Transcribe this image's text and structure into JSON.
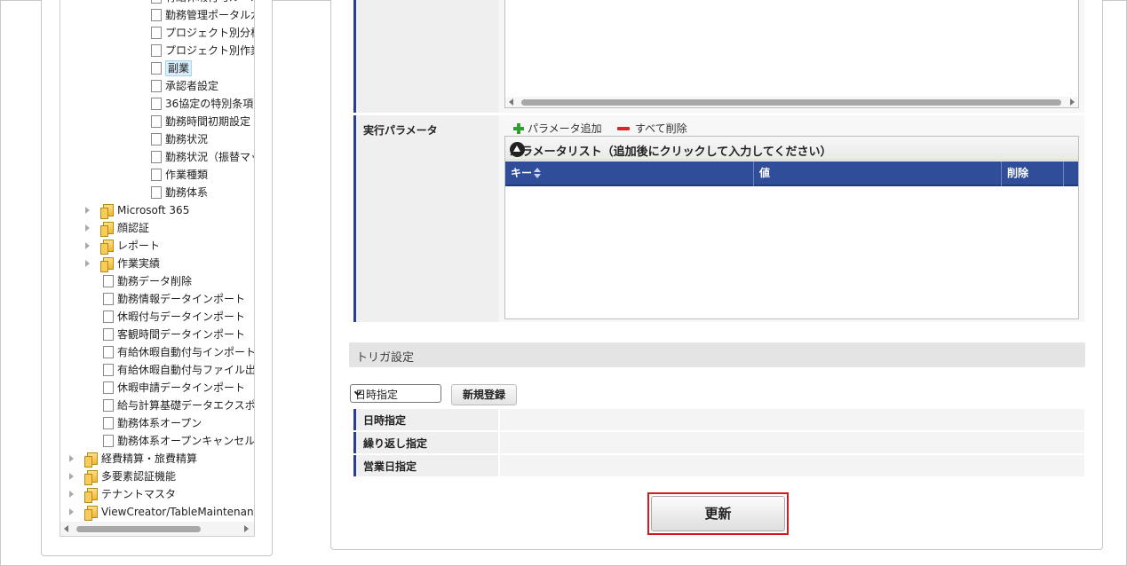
{
  "tree": {
    "items": [
      {
        "label": "有給休暇付与ルール",
        "type": "doc",
        "level": 4
      },
      {
        "label": "勤務管理ポータルガジェ",
        "type": "doc",
        "level": 4
      },
      {
        "label": "プロジェクト別分析",
        "type": "doc",
        "level": 4
      },
      {
        "label": "プロジェクト別作業種",
        "type": "doc",
        "level": 4
      },
      {
        "label": "副業",
        "type": "doc",
        "level": 4,
        "selected": true
      },
      {
        "label": "承認者設定",
        "type": "doc",
        "level": 4
      },
      {
        "label": "36協定の特別条項",
        "type": "doc",
        "level": 4
      },
      {
        "label": "勤務時間初期設定",
        "type": "doc",
        "level": 4
      },
      {
        "label": "勤務状況",
        "type": "doc",
        "level": 4
      },
      {
        "label": "勤務状況（振替マッピ",
        "type": "doc",
        "level": 4
      },
      {
        "label": "作業種類",
        "type": "doc",
        "level": 4
      },
      {
        "label": "勤務体系",
        "type": "doc",
        "level": 4
      },
      {
        "label": "Microsoft 365",
        "type": "folder",
        "level": 3,
        "expandable": true
      },
      {
        "label": "顔認証",
        "type": "folder",
        "level": 3,
        "expandable": true
      },
      {
        "label": "レポート",
        "type": "folder",
        "level": 3,
        "expandable": true
      },
      {
        "label": "作業実績",
        "type": "folder",
        "level": 3,
        "expandable": true
      },
      {
        "label": "勤務データ削除",
        "type": "doc",
        "level": 3
      },
      {
        "label": "勤務情報データインポート",
        "type": "doc",
        "level": 3
      },
      {
        "label": "休暇付与データインポート",
        "type": "doc",
        "level": 3
      },
      {
        "label": "客観時間データインポート",
        "type": "doc",
        "level": 3
      },
      {
        "label": "有給休暇自動付与インポート",
        "type": "doc",
        "level": 3
      },
      {
        "label": "有給休暇自動付与ファイル出",
        "type": "doc",
        "level": 3
      },
      {
        "label": "休暇申請データインポート",
        "type": "doc",
        "level": 3
      },
      {
        "label": "給与計算基礎データエクスポ",
        "type": "doc",
        "level": 3
      },
      {
        "label": "勤務体系オープン",
        "type": "doc",
        "level": 3
      },
      {
        "label": "勤務体系オープンキャンセル",
        "type": "doc",
        "level": 3
      },
      {
        "label": "経費精算・旅費精算",
        "type": "folder",
        "level": 2,
        "expandable": true
      },
      {
        "label": "多要素認証機能",
        "type": "folder",
        "level": 2,
        "expandable": true
      },
      {
        "label": "テナントマスタ",
        "type": "folder",
        "level": 2,
        "expandable": true
      },
      {
        "label": "ViewCreator/TableMaintenance ま",
        "type": "folder",
        "level": 2,
        "expandable": true
      }
    ]
  },
  "params": {
    "label": "実行パラメータ",
    "add_label": "パラメータ追加",
    "delete_all_label": "すべて削除",
    "list_title": "パラメータリスト（追加後にクリックして入力してください）",
    "columns": [
      "キー",
      "値",
      "削除"
    ]
  },
  "trigger": {
    "header": "トリガ設定",
    "select_value": "日時指定",
    "new_button": "新規登録",
    "rows": [
      "日時指定",
      "繰り返し指定",
      "営業日指定"
    ]
  },
  "update_button": "更新"
}
